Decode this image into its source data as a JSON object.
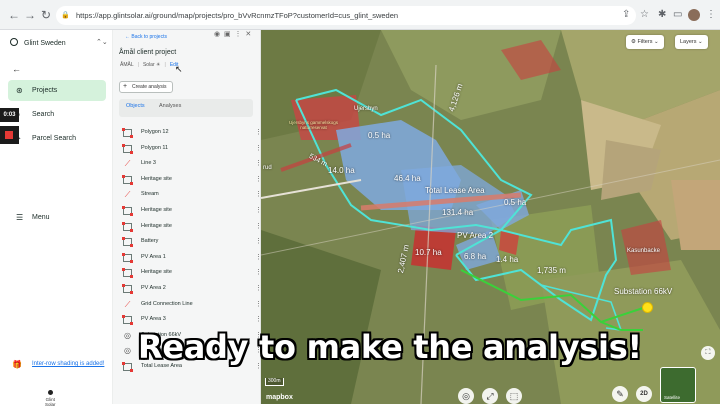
{
  "browser": {
    "url": "https://app.glintsolar.ai/ground/map/projects/pro_bVvRcnmzTFoP?customerId=cus_glint_sweden"
  },
  "sidebar": {
    "org_name": "Glint Sweden",
    "items": [
      {
        "label": "Projects",
        "icon": "projects-icon",
        "active": true
      },
      {
        "label": "Search",
        "icon": "search-icon",
        "active": false
      },
      {
        "label": "Parcel Search",
        "icon": "parcel-search-icon",
        "active": false
      }
    ],
    "menu_label": "Menu",
    "promo_link": "Inter-row shading is added!",
    "brand_line1": "Glint",
    "brand_line2": "Solar",
    "recording_time": "0:03"
  },
  "panel": {
    "back_label": "Back to projects",
    "project_title": "Åmål client project",
    "meta_location": "ÅMÅL",
    "meta_type": "Solar",
    "meta_edit": "Edit",
    "create_analysis_label": "Create analysis",
    "tabs": [
      {
        "label": "Objects",
        "active": true
      },
      {
        "label": "Analyses",
        "active": false
      }
    ],
    "objects": [
      {
        "label": "Polygon 12",
        "kind": "polygon"
      },
      {
        "label": "Polygon 11",
        "kind": "polygon"
      },
      {
        "label": "Line 3",
        "kind": "line"
      },
      {
        "label": "Heritage site",
        "kind": "polygon"
      },
      {
        "label": "Stream",
        "kind": "line"
      },
      {
        "label": "Heritage site",
        "kind": "polygon"
      },
      {
        "label": "Heritage site",
        "kind": "polygon"
      },
      {
        "label": "Battery",
        "kind": "polygon"
      },
      {
        "label": "PV Area 1",
        "kind": "polygon"
      },
      {
        "label": "Heritage site",
        "kind": "polygon"
      },
      {
        "label": "PV Area 2",
        "kind": "polygon"
      },
      {
        "label": "Grid Connection Line",
        "kind": "line"
      },
      {
        "label": "PV Area 3",
        "kind": "polygon"
      },
      {
        "label": "Substation 66kV",
        "kind": "point"
      },
      {
        "label": "Substation 66kV",
        "kind": "point"
      },
      {
        "label": "Total Lease Area",
        "kind": "polygon"
      }
    ]
  },
  "map": {
    "filters_label": "Filters",
    "layers_label": "Layers",
    "labels": {
      "area_a": "0.5 ha",
      "area_b": "14.0 ha",
      "area_c": "46.4 ha",
      "total_lease": "Total Lease Area",
      "area_d": "131.4 ha",
      "area_e": "0.5 ha",
      "pv_area_2": "PV Area 2",
      "area_f": "10.7 ha",
      "area_g": "6.8 ha",
      "area_h": "1.4 ha",
      "dist_1": "1,735 m",
      "dist_2": "4,126 m",
      "dist_3": "2,407 m",
      "dist_4": "534 m",
      "substation": "Substation 66kV",
      "place_1": "Ujersbyn",
      "place_2": "Kasunbacke",
      "reserve": "Ujersbyns gammelskogs naturreservat",
      "rud": "rud"
    },
    "scale_label": "300m",
    "attribution": "mapbox",
    "view_mode": "2D",
    "basemap_label": "Satellite"
  },
  "caption": "Ready to make the analysis!",
  "colors": {
    "accent_green": "#d5f2dc",
    "link_blue": "#1a73e8",
    "boundary_cyan": "#4fe3d6",
    "pv_blue": "#7fa9df",
    "heritage_red": "#d23b3b",
    "grid_line_green": "#3ad13a"
  }
}
